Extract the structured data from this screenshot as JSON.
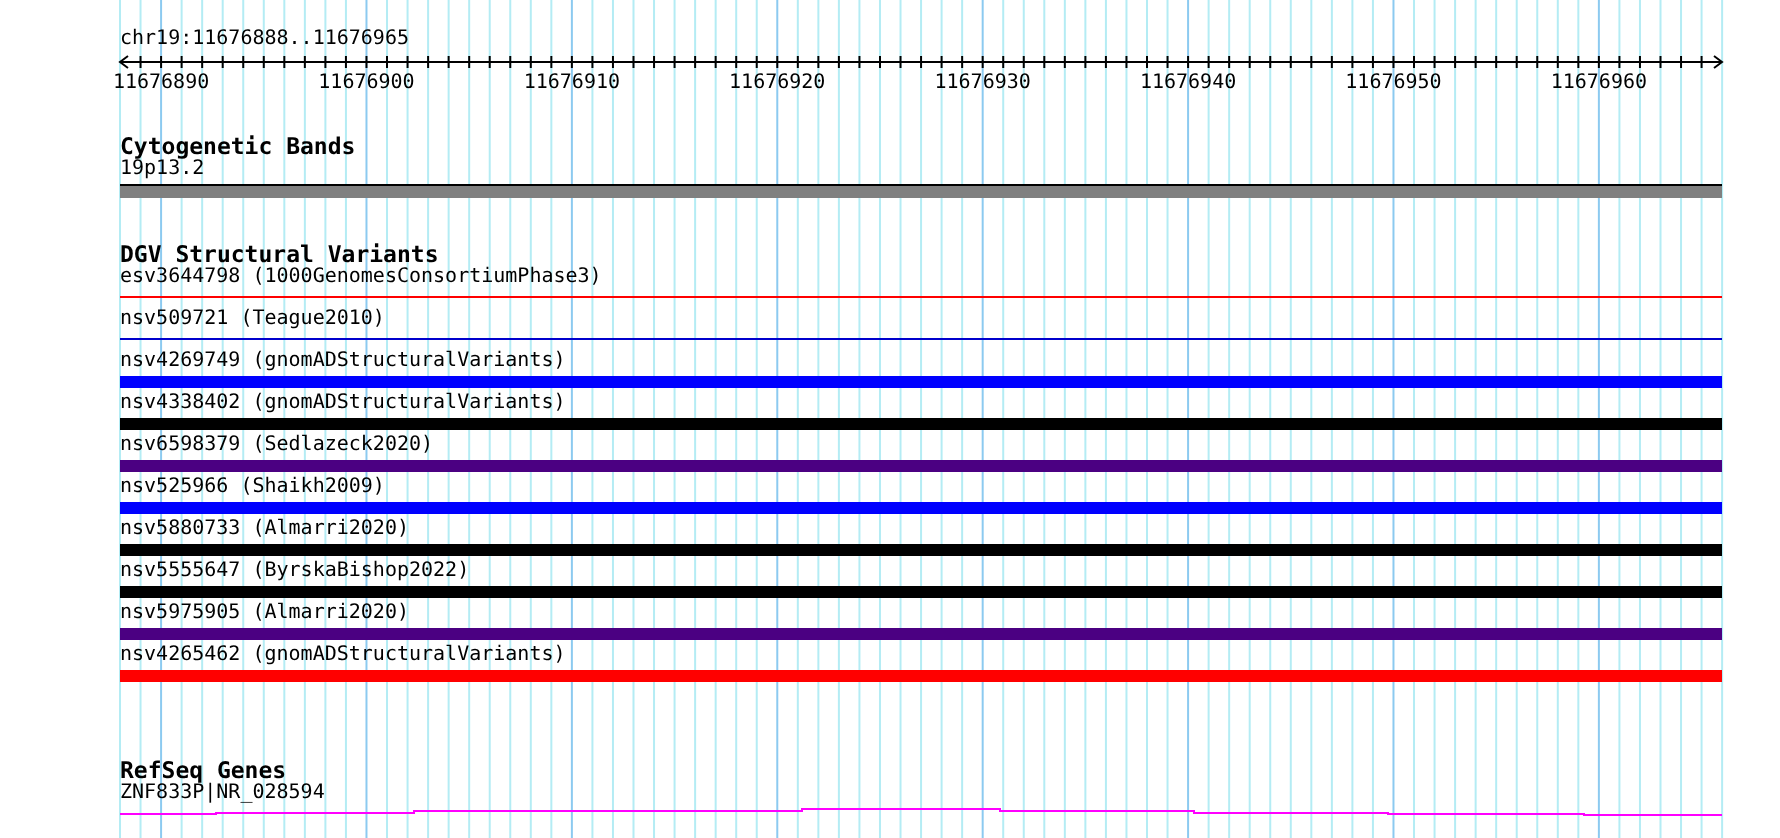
{
  "ruler": {
    "position": "chr19:11676888..11676965",
    "tick_labels": [
      "11676890",
      "11676900",
      "11676910",
      "11676920",
      "11676930",
      "11676940",
      "11676950",
      "11676960"
    ]
  },
  "cytogenetic_bands": {
    "title": "Cytogenetic Bands",
    "band": "19p13.2"
  },
  "dgv": {
    "title": "DGV Structural Variants",
    "variants": [
      {
        "label": "esv3644798 (1000GenomesConsortiumPhase3)",
        "kind": "line",
        "color": "#ff0000"
      },
      {
        "label": "nsv509721 (Teague2010)",
        "kind": "line",
        "color": "#0000cc"
      },
      {
        "label": "nsv4269749 (gnomADStructuralVariants)",
        "kind": "bar",
        "color": "#0000ff"
      },
      {
        "label": "nsv4338402 (gnomADStructuralVariants)",
        "kind": "bar",
        "color": "#000000"
      },
      {
        "label": "nsv6598379 (Sedlazeck2020)",
        "kind": "bar",
        "color": "#4b0082"
      },
      {
        "label": "nsv525966 (Shaikh2009)",
        "kind": "bar",
        "color": "#0000ff"
      },
      {
        "label": "nsv5880733 (Almarri2020)",
        "kind": "bar",
        "color": "#000000"
      },
      {
        "label": "nsv5555647 (ByrskaBishop2022)",
        "kind": "bar",
        "color": "#000000"
      },
      {
        "label": "nsv5975905 (Almarri2020)",
        "kind": "bar",
        "color": "#4b0082"
      },
      {
        "label": "nsv4265462 (gnomADStructuralVariants)",
        "kind": "bar",
        "color": "#ff0000"
      }
    ]
  },
  "refseq": {
    "title": "RefSeq Genes",
    "gene": "ZNF833P|NR_028594"
  }
}
